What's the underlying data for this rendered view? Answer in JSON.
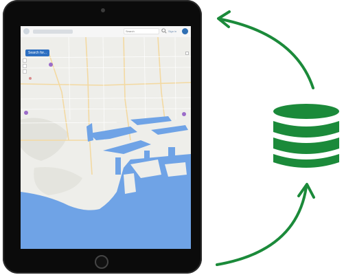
{
  "device": {
    "type": "tablet",
    "frame_color": "#0b0b0b"
  },
  "app": {
    "search": {
      "placeholder": "Search"
    },
    "signin_label": "Sign in",
    "feature_button_label": "Search for..."
  },
  "map": {
    "water_color": "#6fa3e6",
    "land_color": "#eeeeea",
    "road_color": "#f3d9a1"
  },
  "icons": {
    "database": "database-icon",
    "arrow_top": "curved-arrow-icon",
    "arrow_bottom": "curved-arrow-icon"
  },
  "colors": {
    "accent_green": "#1b8a3a",
    "button_blue": "#2d6fc1"
  }
}
